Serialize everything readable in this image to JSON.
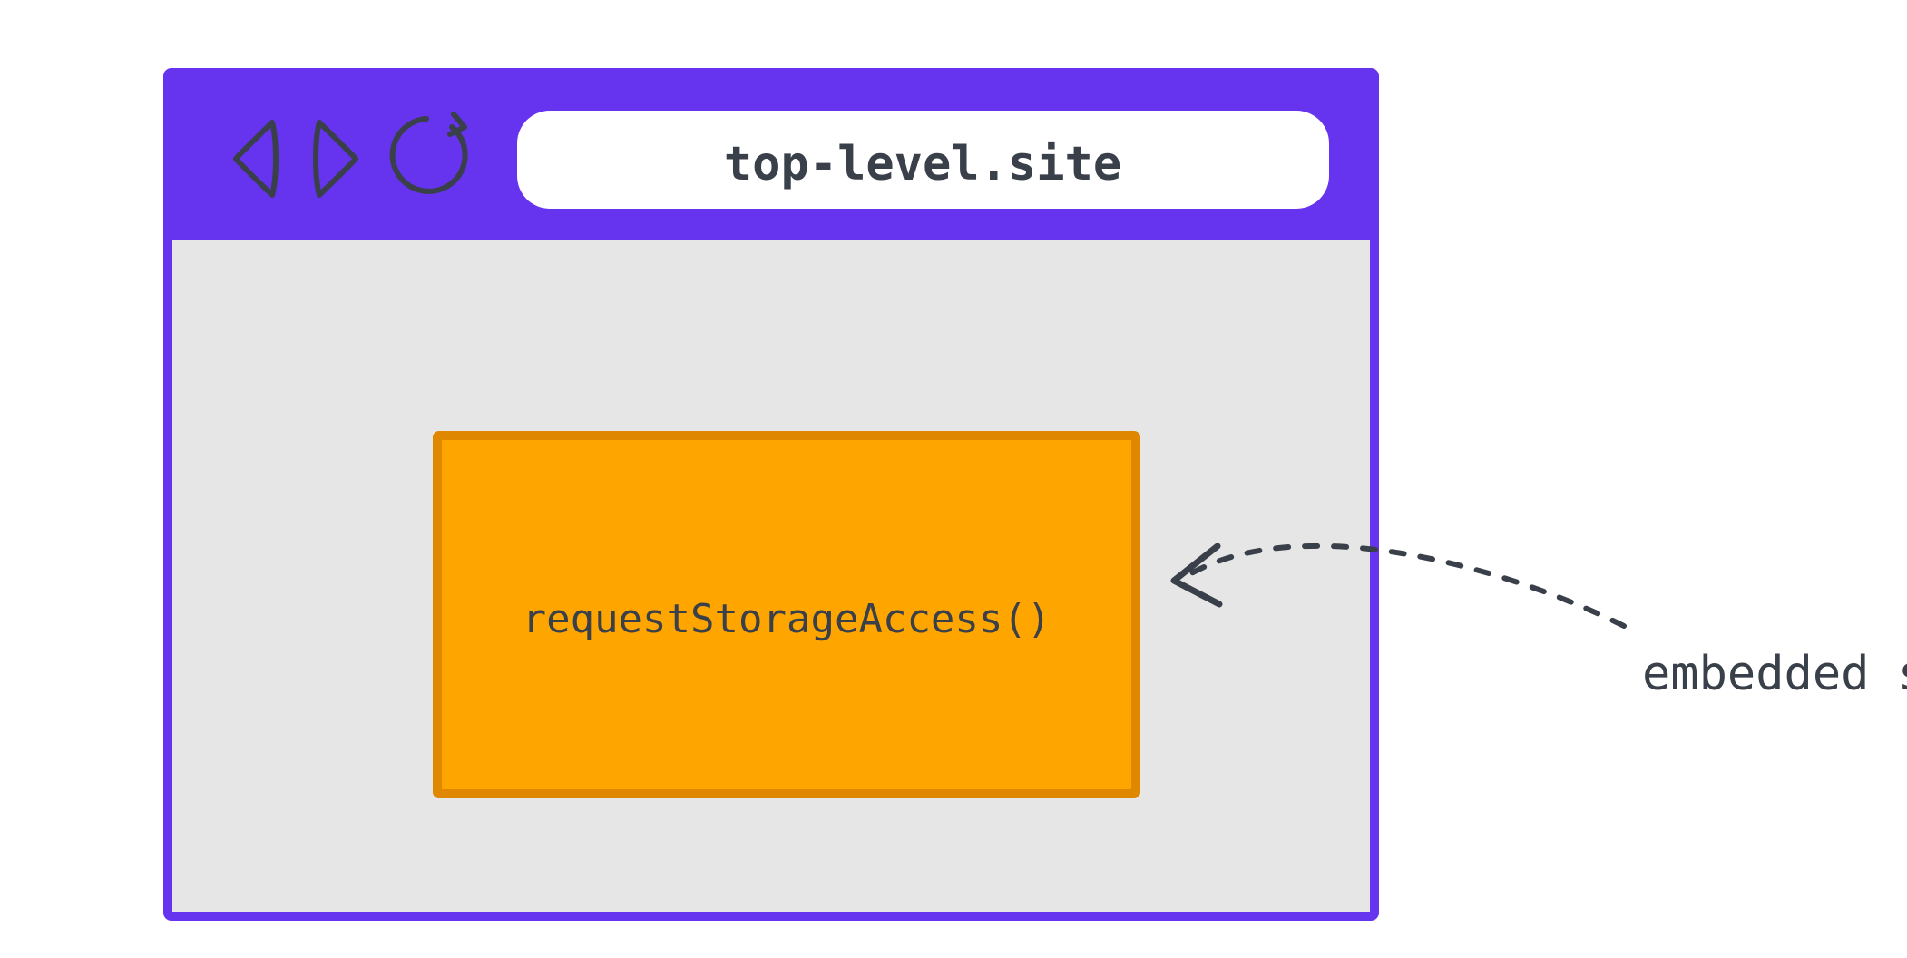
{
  "browser": {
    "address_bar": "top-level.site",
    "nav": {
      "back_icon": "back",
      "forward_icon": "forward",
      "reload_icon": "reload"
    }
  },
  "iframe": {
    "code": "requestStorageAccess()"
  },
  "annotation": {
    "label": "embedded site"
  },
  "colors": {
    "purple": "#6633ee",
    "page_bg": "#e6e6e6",
    "iframe_fill": "#ffa500",
    "iframe_stroke": "#e08700",
    "text": "#3a404a",
    "white": "#ffffff"
  }
}
